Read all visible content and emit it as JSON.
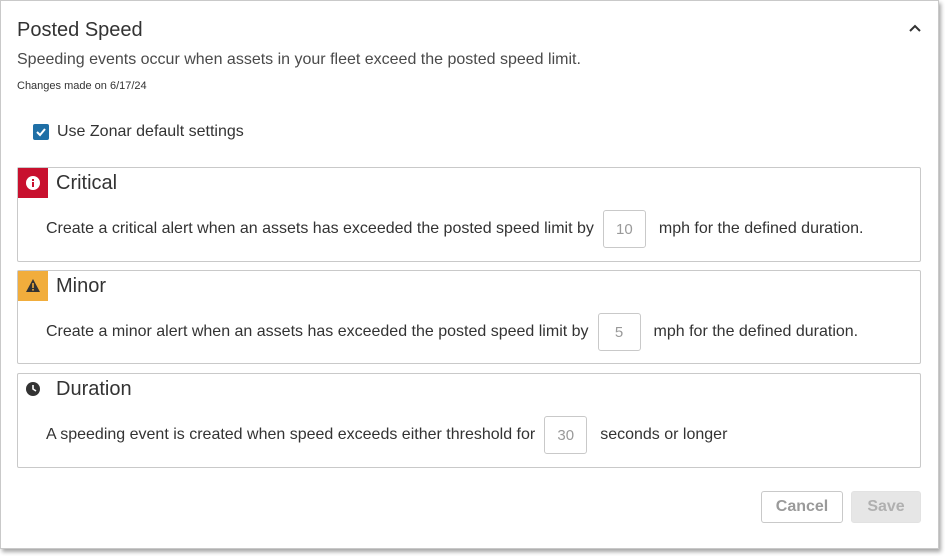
{
  "header": {
    "title": "Posted Speed",
    "subtitle": "Speeding events occur when assets in your fleet exceed the posted speed limit.",
    "changes": "Changes made on 6/17/24"
  },
  "default_settings": {
    "label": "Use Zonar default settings",
    "checked": true
  },
  "critical": {
    "title": "Critical",
    "text_before": "Create a critical alert when an assets has exceeded the posted speed limit by",
    "value": "10",
    "text_after": "mph for the defined duration.",
    "color": "#c8102e"
  },
  "minor": {
    "title": "Minor",
    "text_before": "Create a minor alert when an assets has exceeded the posted speed limit by",
    "value": "5",
    "text_after": "mph for the defined duration.",
    "color": "#f1ad3c"
  },
  "duration": {
    "title": "Duration",
    "text_before": "A speeding event is created when speed exceeds either threshold for",
    "value": "30",
    "text_after": "seconds or longer"
  },
  "buttons": {
    "cancel": "Cancel",
    "save": "Save"
  },
  "icons": {
    "collapse": "chevron-up-icon",
    "critical": "info-icon",
    "minor": "warning-icon",
    "duration": "clock-icon"
  }
}
